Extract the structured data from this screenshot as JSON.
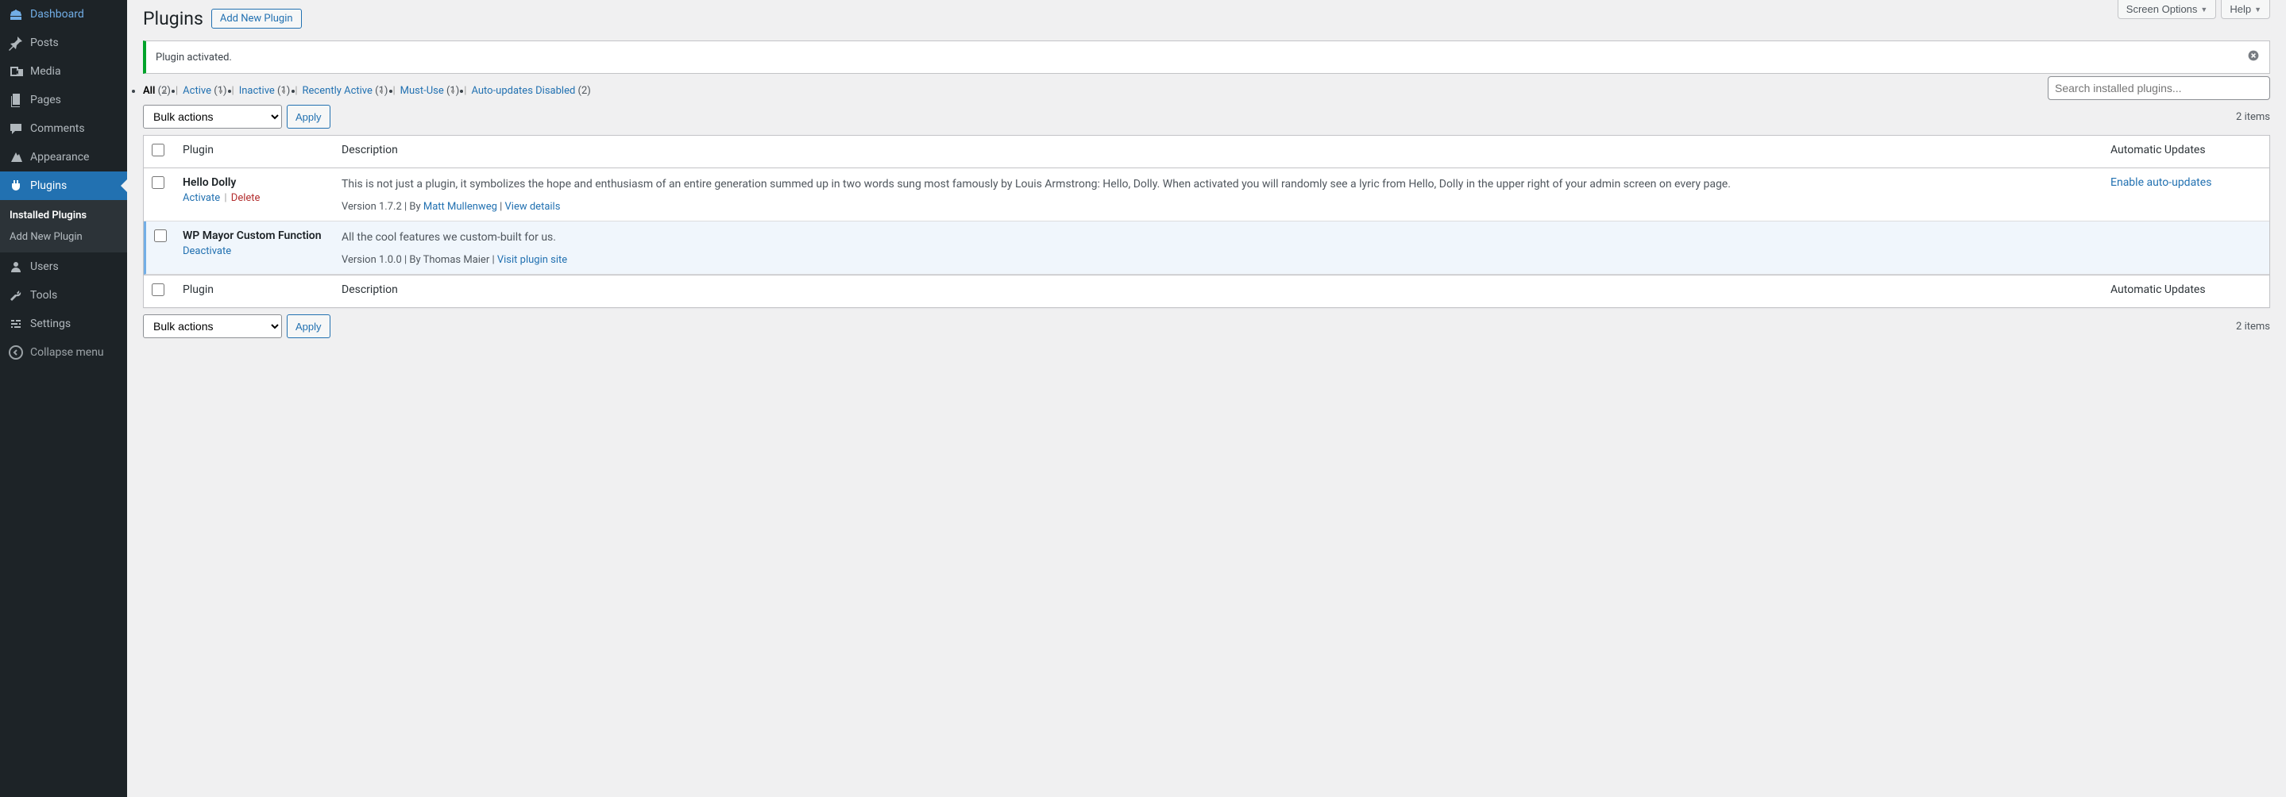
{
  "sidebar": {
    "items": [
      {
        "id": "dashboard",
        "label": "Dashboard",
        "icon": "dashboard-icon"
      },
      {
        "id": "posts",
        "label": "Posts",
        "icon": "pin-icon"
      },
      {
        "id": "media",
        "label": "Media",
        "icon": "media-icon"
      },
      {
        "id": "pages",
        "label": "Pages",
        "icon": "pages-icon"
      },
      {
        "id": "comments",
        "label": "Comments",
        "icon": "comments-icon"
      },
      {
        "id": "appearance",
        "label": "Appearance",
        "icon": "appearance-icon"
      },
      {
        "id": "plugins",
        "label": "Plugins",
        "icon": "plugin-icon",
        "current": true
      },
      {
        "id": "users",
        "label": "Users",
        "icon": "users-icon"
      },
      {
        "id": "tools",
        "label": "Tools",
        "icon": "tools-icon"
      },
      {
        "id": "settings",
        "label": "Settings",
        "icon": "settings-icon"
      }
    ],
    "submenu": [
      {
        "id": "installed",
        "label": "Installed Plugins",
        "current": true
      },
      {
        "id": "addnew",
        "label": "Add New Plugin"
      }
    ],
    "collapse": "Collapse menu"
  },
  "topTabs": {
    "screenOptions": "Screen Options",
    "help": "Help"
  },
  "header": {
    "title": "Plugins",
    "action": "Add New Plugin"
  },
  "notice": {
    "text": "Plugin activated."
  },
  "filters": [
    {
      "id": "all",
      "label": "All",
      "count": "(2)",
      "current": true
    },
    {
      "id": "active",
      "label": "Active",
      "count": "(1)"
    },
    {
      "id": "inactive",
      "label": "Inactive",
      "count": "(1)"
    },
    {
      "id": "recent",
      "label": "Recently Active",
      "count": "(1)"
    },
    {
      "id": "mustuse",
      "label": "Must-Use",
      "count": "(1)"
    },
    {
      "id": "autodis",
      "label": "Auto-updates Disabled",
      "count": "(2)"
    }
  ],
  "search": {
    "placeholder": "Search installed plugins..."
  },
  "bulk": {
    "label": "Bulk actions",
    "apply": "Apply"
  },
  "itemCount": "2 items",
  "columns": {
    "plugin": "Plugin",
    "description": "Description",
    "autoupdates": "Automatic Updates"
  },
  "plugins": [
    {
      "name": "Hello Dolly",
      "active": false,
      "actions": [
        {
          "label": "Activate",
          "type": "link"
        },
        {
          "label": "Delete",
          "type": "delete"
        }
      ],
      "description": "This is not just a plugin, it symbolizes the hope and enthusiasm of an entire generation summed up in two words sung most famously by Louis Armstrong: Hello, Dolly. When activated you will randomly see a lyric from Hello, Dolly in the upper right of your admin screen on every page.",
      "metaPrefix": "Version 1.7.2 | By ",
      "author": "Matt Mullenweg",
      "metaSep": " | ",
      "detailLink": "View details",
      "autoUpdate": "Enable auto-updates"
    },
    {
      "name": "WP Mayor Custom Function",
      "active": true,
      "actions": [
        {
          "label": "Deactivate",
          "type": "link"
        }
      ],
      "description": "All the cool features we custom-built for us.",
      "metaPrefix": "Version 1.0.0 | By Thomas Maier | ",
      "author": "",
      "metaSep": "",
      "detailLink": "Visit plugin site",
      "autoUpdate": ""
    }
  ]
}
